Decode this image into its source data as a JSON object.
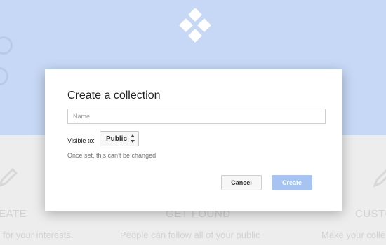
{
  "background": {
    "features": [
      {
        "heading": "EATE",
        "text": "for your interests."
      },
      {
        "heading": "GET FOUND",
        "text": "People can follow all of your public"
      },
      {
        "heading": "CUSTO",
        "text": "Make your colle"
      }
    ],
    "icons": [
      "pencil-icon",
      "pencil-icon"
    ],
    "colors": {
      "banner": "#c6d8f5",
      "lower": "#ededed",
      "logo": "#ffffff"
    }
  },
  "dialog": {
    "title": "Create a collection",
    "name_placeholder": "Name",
    "name_value": "",
    "visible_label": "Visible to:",
    "visibility_selected": "Public",
    "hint": "Once set, this can’t be changed",
    "cancel_label": "Cancel",
    "create_label": "Create",
    "colors": {
      "create_button": "#a7c3f2"
    }
  }
}
